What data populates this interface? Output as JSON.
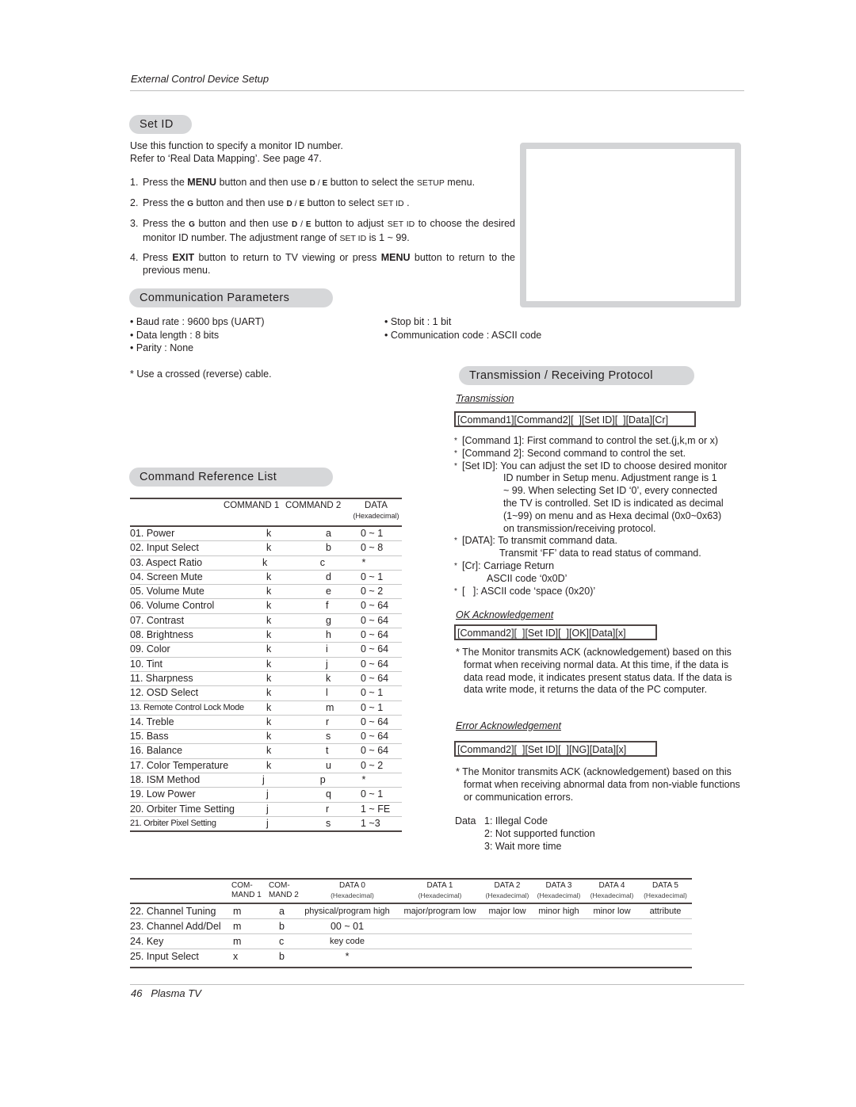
{
  "header": {
    "title": "External Control Device Setup"
  },
  "set_id": {
    "heading": "Set ID",
    "intro_1": "Use this function to specify a monitor ID number.",
    "intro_2": "Refer to ‘Real Data Mapping’. See page 47.",
    "steps": [
      {
        "num": "1.",
        "parts": [
          "Press the ",
          "MENU",
          " button and then use ",
          "D",
          " / ",
          "E",
          "  button to select the ",
          "SETUP",
          "  menu."
        ]
      },
      {
        "num": "2.",
        "parts": [
          "Press the ",
          "G",
          " button and then use ",
          "D",
          " / ",
          "E",
          "  button to select ",
          "SET ID",
          " ."
        ]
      },
      {
        "num": "3.",
        "parts": [
          "Press the ",
          "G",
          "  button and then use ",
          "D",
          "  / ",
          "E",
          "  button to adjust ",
          "SET ID",
          "  to choose the desired monitor ID number. The adjustment range of ",
          "SET ID",
          "  is 1 ~ 99."
        ]
      },
      {
        "num": "4.",
        "parts": [
          "Press ",
          "EXIT",
          " button to return to TV viewing or press ",
          "MENU",
          " button to return to the previous menu."
        ]
      }
    ]
  },
  "communication": {
    "heading": "Communication Parameters",
    "left": [
      "Baud rate : 9600 bps (UART)",
      "Data length : 8 bits",
      "Parity : None"
    ],
    "right": [
      "Stop bit : 1 bit",
      "Communication code : ASCII code"
    ],
    "bullet": "•",
    "note": "* Use a crossed (reverse) cable."
  },
  "command_list": {
    "heading": "Command Reference List",
    "columns": {
      "command1": "COMMAND 1",
      "command2": "COMMAND 2",
      "data": "DATA",
      "data_sub": "(Hexadecimal)"
    },
    "rows": [
      {
        "name": "01. Power",
        "c1": "k",
        "c2": "a",
        "data": "0 ~ 1"
      },
      {
        "name": "02. Input Select",
        "c1": "k",
        "c2": "b",
        "data": "0 ~ 8"
      },
      {
        "name": "03. Aspect Ratio",
        "c1": "k",
        "c2": "c",
        "data": "*"
      },
      {
        "name": "04. Screen Mute",
        "c1": "k",
        "c2": "d",
        "data": "0 ~ 1"
      },
      {
        "name": "05. Volume Mute",
        "c1": "k",
        "c2": "e",
        "data": "0 ~ 2"
      },
      {
        "name": "06. Volume Control",
        "c1": "k",
        "c2": "f",
        "data": "0 ~ 64"
      },
      {
        "name": "07. Contrast",
        "c1": "k",
        "c2": "g",
        "data": "0 ~ 64"
      },
      {
        "name": "08. Brightness",
        "c1": "k",
        "c2": "h",
        "data": "0 ~ 64"
      },
      {
        "name": "09. Color",
        "c1": "k",
        "c2": "i",
        "data": "0 ~ 64"
      },
      {
        "name": "10. Tint",
        "c1": "k",
        "c2": "j",
        "data": "0 ~ 64"
      },
      {
        "name": "11. Sharpness",
        "c1": "k",
        "c2": "k",
        "data": "0 ~ 64"
      },
      {
        "name": "12. OSD Select",
        "c1": "k",
        "c2": "l",
        "data": "0 ~ 1"
      },
      {
        "name": "13. Remote Control Lock Mode",
        "c1": "k",
        "c2": "m",
        "data": "0 ~ 1"
      },
      {
        "name": "14. Treble",
        "c1": "k",
        "c2": "r",
        "data": "0 ~ 64"
      },
      {
        "name": "15. Bass",
        "c1": "k",
        "c2": "s",
        "data": "0 ~ 64"
      },
      {
        "name": "16. Balance",
        "c1": "k",
        "c2": "t",
        "data": "0 ~ 64"
      },
      {
        "name": "17. Color Temperature",
        "c1": "k",
        "c2": "u",
        "data": "0 ~ 2"
      },
      {
        "name": "18. ISM Method",
        "c1": "j",
        "c2": "p",
        "data": "*"
      },
      {
        "name": "19. Low Power",
        "c1": "j",
        "c2": "q",
        "data": "0 ~ 1"
      },
      {
        "name": "20. Orbiter Time Setting",
        "c1": "j",
        "c2": "r",
        "data": "1 ~ FE"
      },
      {
        "name": "21. Orbiter Pixel Setting",
        "c1": "j",
        "c2": "s",
        "data": "1 ~3"
      }
    ]
  },
  "protocol": {
    "heading": "Transmission / Receiving  Protocol",
    "transmission_label": "Transmission",
    "transmission_format": "[Command1][Command2][  ][Set ID][  ][Data][Cr]",
    "notes": [
      {
        "star": "*",
        "label": "[Command 1]: ",
        "text": "First command to control the set.(j,k,m or x)"
      },
      {
        "star": "*",
        "label": "[Command 2]: ",
        "text": "Second command to control the set."
      },
      {
        "star": "*",
        "label": "[Set ID]: ",
        "text": "You can adjust the set ID to choose desired monitor",
        "cont": [
          "ID number in Setup menu. Adjustment range is 1",
          "~ 99. When selecting Set ID ‘0’, every connected",
          "the TV is controlled. Set ID is indicated as decimal",
          "(1~99) on menu and as Hexa decimal (0x0~0x63)",
          "on transmission/receiving protocol."
        ]
      },
      {
        "star": "*",
        "label": "[DATA]: ",
        "text": "To transmit command data.",
        "cont": [
          "Transmit ‘FF’ data to read status of command."
        ]
      },
      {
        "star": "*",
        "label": "[Cr]: ",
        "text": "Carriage Return",
        "cont": [
          "ASCII code ‘0x0D’"
        ]
      },
      {
        "star": "*",
        "label": "[   ]: ",
        "text": "ASCII code ‘space (0x20)’"
      }
    ],
    "ok_label": "OK Acknowledgement",
    "ok_format": "[Command2][  ][Set ID][  ][OK][Data][x]",
    "ok_note": "* The Monitor transmits ACK (acknowledgement) based on this format when receiving normal data. At this time, if the data is data read mode, it indicates present status data. If the data is data write mode, it returns the data of the PC computer.",
    "error_label": "Error Acknowledgement",
    "error_format": "[Command2][  ][Set ID][  ][NG][Data][x]",
    "error_note": "* The Monitor transmits ACK (acknowledgement) based on this format when receiving abnormal data from non-viable functions or communication errors.",
    "data_label": "Data",
    "data_codes": [
      "1: Illegal Code",
      "2: Not supported function",
      "3: Wait more time"
    ]
  },
  "extended_table": {
    "columns": [
      {
        "l1": "COM-",
        "l2": "MAND 1"
      },
      {
        "l1": "COM-",
        "l2": "MAND 2"
      },
      {
        "l1": "DATA 0",
        "l2": "(Hexadecimal)"
      },
      {
        "l1": "DATA 1",
        "l2": "(Hexadecimal)"
      },
      {
        "l1": "DATA 2",
        "l2": "(Hexadecimal)"
      },
      {
        "l1": "DATA 3",
        "l2": "(Hexadecimal)"
      },
      {
        "l1": "DATA 4",
        "l2": "(Hexadecimal)"
      },
      {
        "l1": "DATA 5",
        "l2": "(Hexadecimal)"
      }
    ],
    "rows": [
      {
        "name": "22. Channel Tuning",
        "c1": "m",
        "c2": "a",
        "d0": "physical/program high",
        "d1": "major/program low",
        "d2": "major low",
        "d3": "minor high",
        "d4": "minor low",
        "d5": "attribute"
      },
      {
        "name": "23. Channel Add/Del",
        "c1": "m",
        "c2": "b",
        "d0": "00 ~ 01",
        "d1": "",
        "d2": "",
        "d3": "",
        "d4": "",
        "d5": ""
      },
      {
        "name": "24. Key",
        "c1": "m",
        "c2": "c",
        "d0": "key code",
        "d1": "",
        "d2": "",
        "d3": "",
        "d4": "",
        "d5": ""
      },
      {
        "name": "25. Input Select",
        "c1": "x",
        "c2": "b",
        "d0": "*",
        "d1": "",
        "d2": "",
        "d3": "",
        "d4": "",
        "d5": ""
      }
    ]
  },
  "footer": {
    "page": "46",
    "title": "Plasma TV"
  }
}
